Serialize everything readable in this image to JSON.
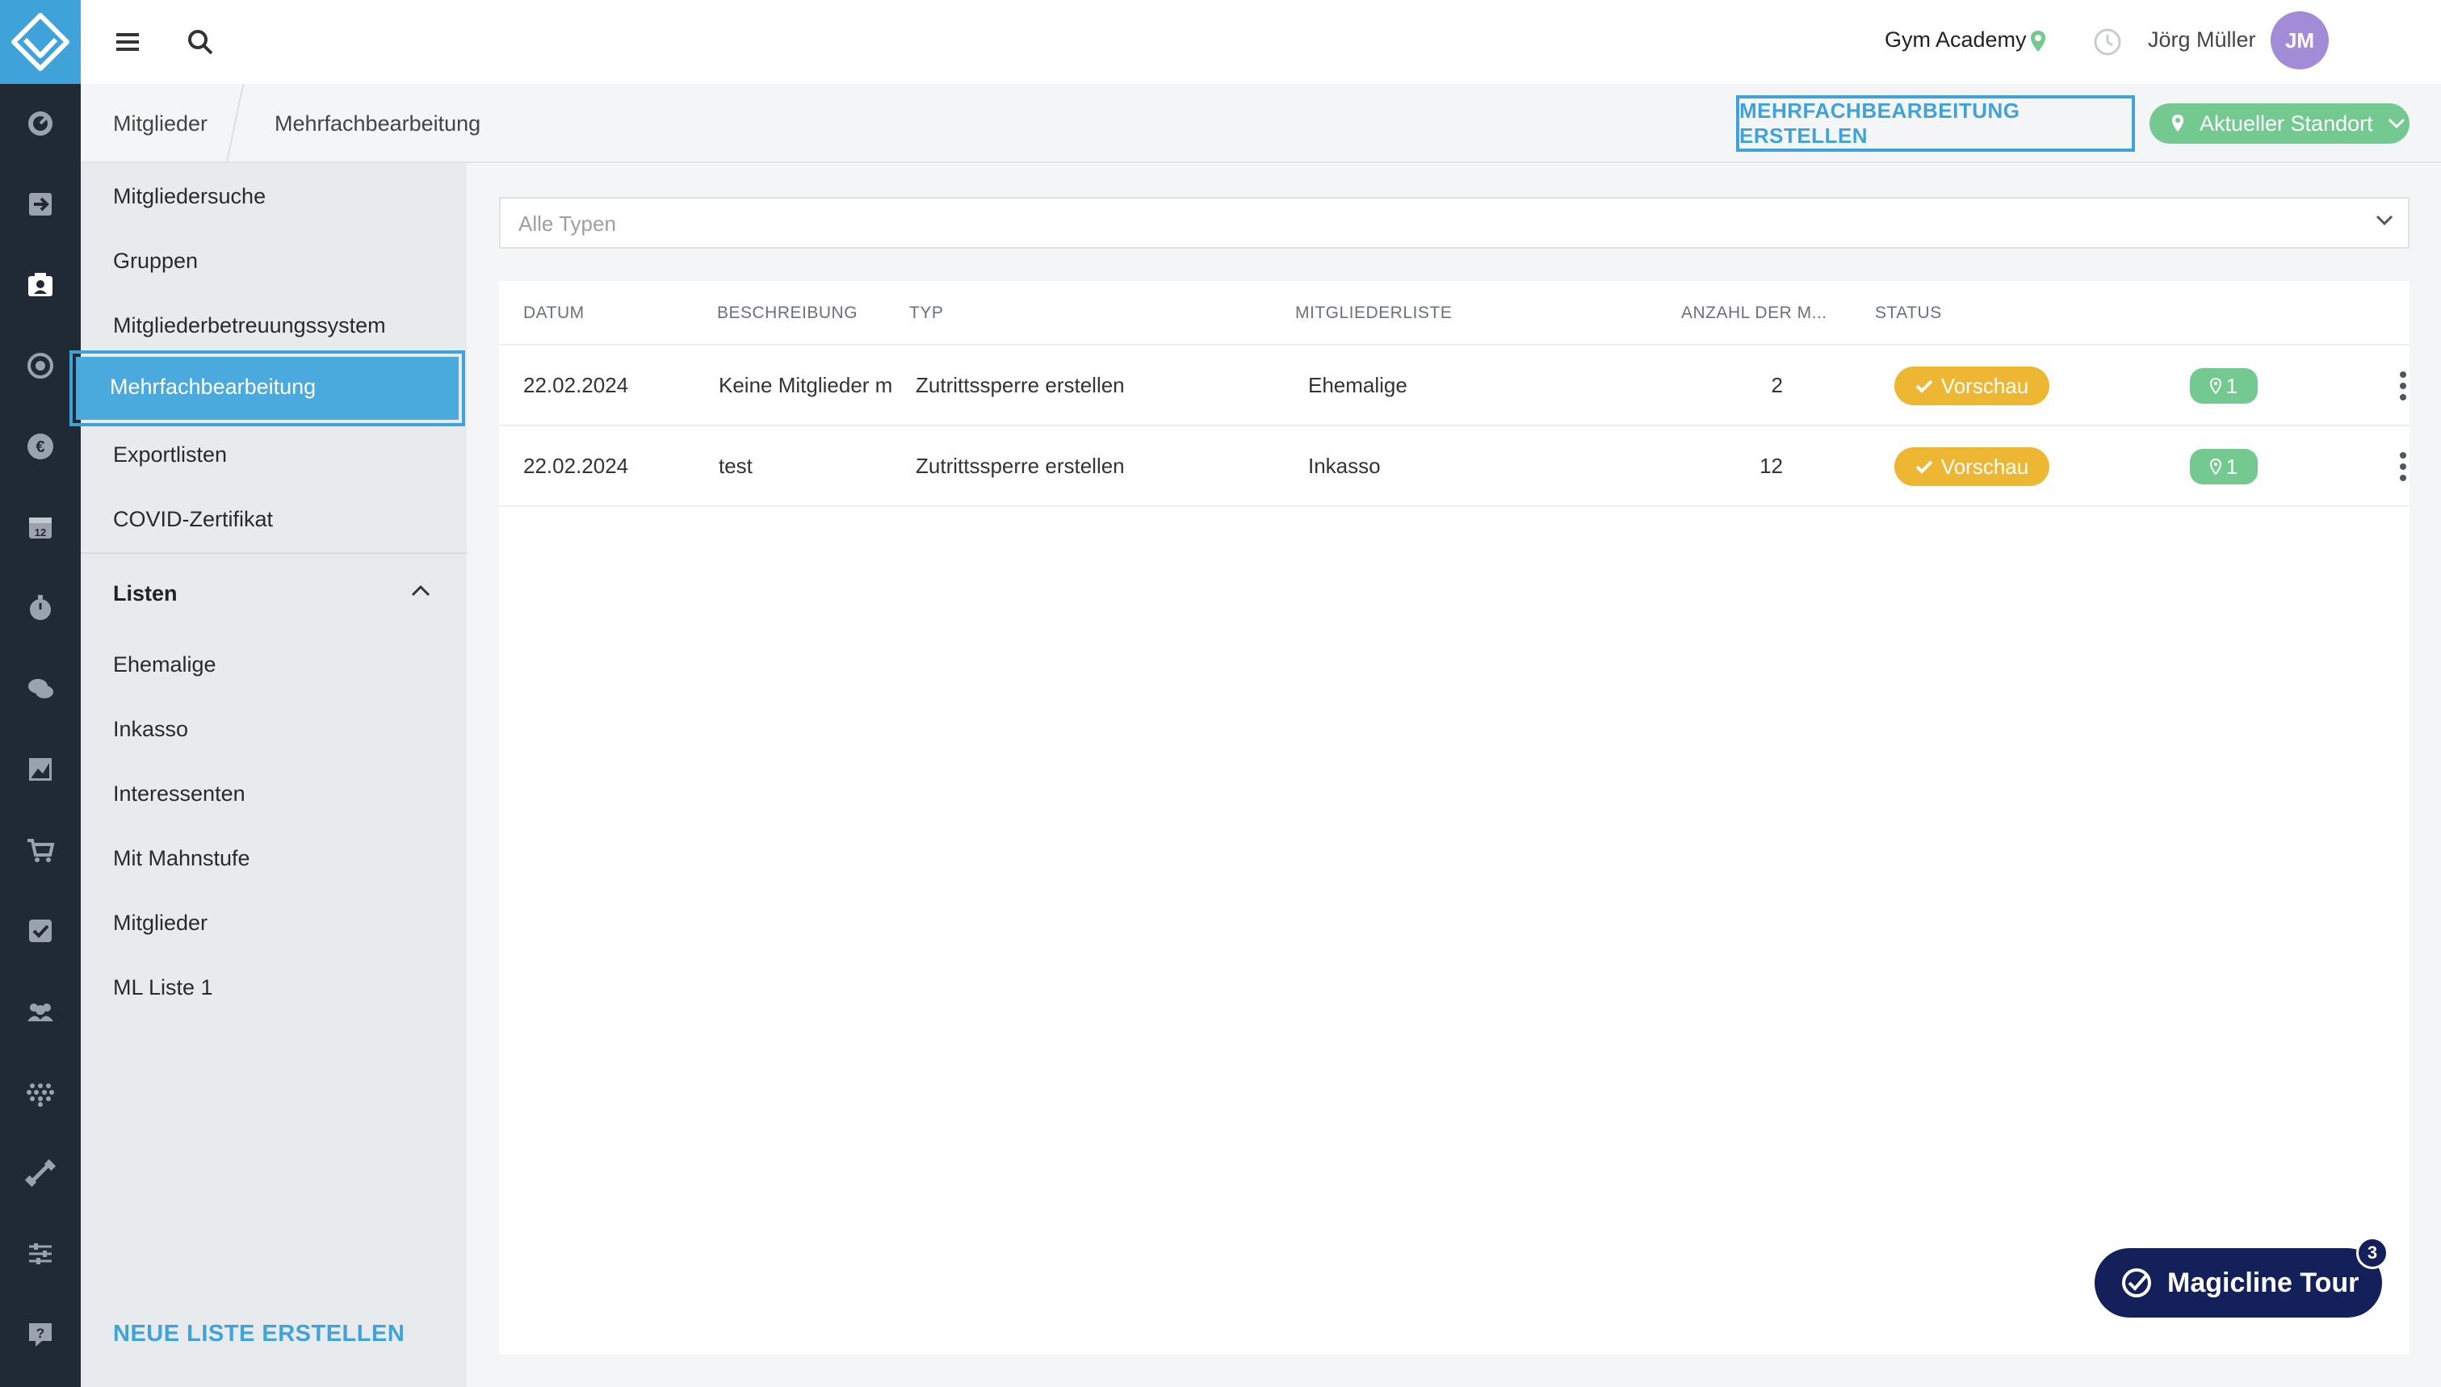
{
  "topbar": {
    "location": "Gym Academy",
    "user_name": "Jörg Müller",
    "avatar_initials": "JM"
  },
  "breadcrumb": {
    "root": "Mitglieder",
    "current": "Mehrfachbearbeitung"
  },
  "actions": {
    "create_label": "MEHRFACHBEARBEITUNG ERSTELLEN",
    "location_label": "Aktueller Standort"
  },
  "sidebar": {
    "items": [
      {
        "label": "Mitgliedersuche"
      },
      {
        "label": "Gruppen"
      },
      {
        "label": "Mitgliederbetreuungssystem"
      },
      {
        "label": "Mehrfachbearbeitung",
        "active": true
      },
      {
        "label": "Exportlisten"
      },
      {
        "label": "COVID-Zertifikat"
      }
    ],
    "lists_heading": "Listen",
    "lists": [
      {
        "label": "Ehemalige"
      },
      {
        "label": "Inkasso"
      },
      {
        "label": "Interessenten"
      },
      {
        "label": "Mit Mahnstufe"
      },
      {
        "label": "Mitglieder"
      },
      {
        "label": "ML Liste 1"
      }
    ],
    "new_list_label": "NEUE LISTE ERSTELLEN"
  },
  "filter": {
    "placeholder": "Alle Typen"
  },
  "table": {
    "columns": [
      "DATUM",
      "BESCHREIBUNG",
      "TYP",
      "MITGLIEDERLISTE",
      "ANZAHL DER M...",
      "STATUS"
    ],
    "rows": [
      {
        "datum": "22.02.2024",
        "beschreibung": "Keine Mitglieder m",
        "typ": "Zutrittssperre erstellen",
        "liste": "Ehemalige",
        "anzahl": "2",
        "status": "Vorschau",
        "standorte": "1"
      },
      {
        "datum": "22.02.2024",
        "beschreibung": "test",
        "typ": "Zutrittssperre erstellen",
        "liste": "Inkasso",
        "anzahl": "12",
        "status": "Vorschau",
        "standorte": "1"
      }
    ]
  },
  "tour": {
    "label": "Magicline Tour",
    "count": "3"
  },
  "colors": {
    "accent": "#3fa2d8",
    "rail": "#1f2a34",
    "status_preview": "#edb733",
    "location_green": "#73c98f",
    "tour_navy": "#13205a"
  },
  "rail_icons": [
    "dashboard-icon",
    "checkin-icon",
    "members-icon",
    "settings-icon",
    "finance-icon",
    "calendar-icon",
    "timer-icon",
    "chat-icon",
    "analytics-icon",
    "shop-icon",
    "tasks-icon",
    "groups-icon",
    "devices-icon",
    "training-icon",
    "config-icon",
    "help-icon"
  ]
}
